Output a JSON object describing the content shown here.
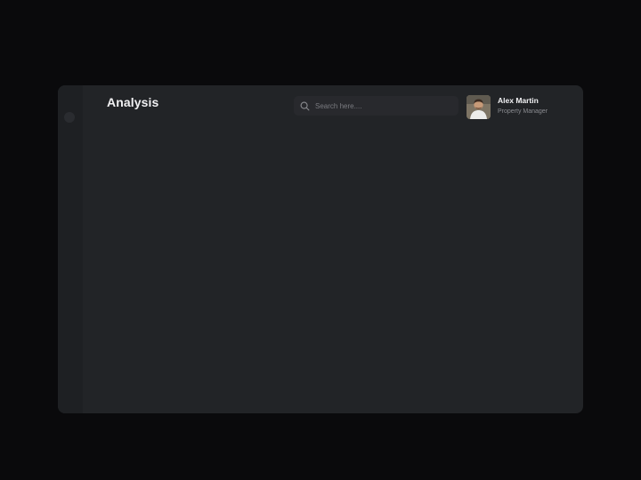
{
  "header": {
    "title": "Analysis"
  },
  "search": {
    "placeholder": "Search here....",
    "icon": "search-icon"
  },
  "user": {
    "name": "Alex Martin",
    "role": "Property Manager",
    "avatar": "avatar-photo"
  },
  "colors": {
    "backdrop": "#0a0a0c",
    "panel": "#222427",
    "sidebar": "#1e2023",
    "search_bg": "#28292d",
    "text_primary": "#f1f1f3",
    "text_muted": "#8a8b90"
  }
}
